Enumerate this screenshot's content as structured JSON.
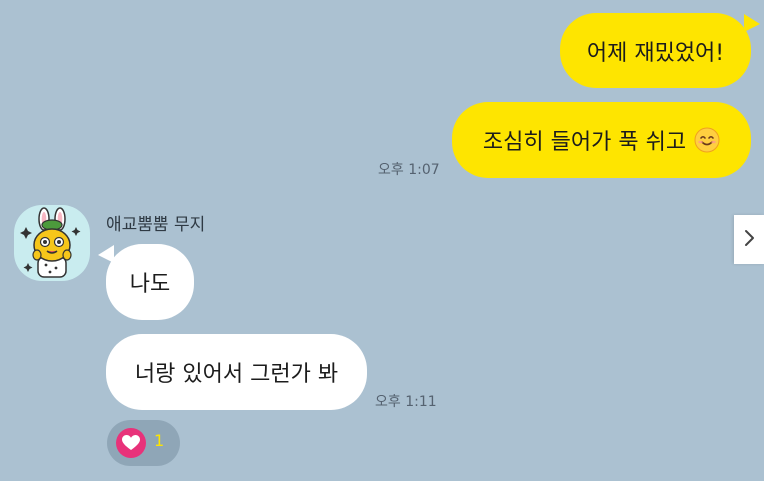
{
  "messages_out": [
    {
      "text": "어제 재밌었어!"
    },
    {
      "text": "조심히 들어가 푹 쉬고",
      "emoji_icon": "smiling-face-emoji",
      "time": "오후 1:07"
    }
  ],
  "incoming": {
    "sender": "애교뿜뿜 무지",
    "avatar_icon": "muzi-rabbit-sticker-avatar",
    "messages": [
      {
        "text": "나도"
      },
      {
        "text": "너랑 있어서 그런가 봐",
        "time": "오후 1:11"
      }
    ],
    "reaction": {
      "icon": "heart-icon",
      "count": "1"
    }
  },
  "side_button": {
    "icon": "chevron-right-icon"
  },
  "colors": {
    "background": "#abc1d1",
    "my_bubble": "#fee500",
    "their_bubble": "#ffffff",
    "heart": "#e8327a"
  }
}
